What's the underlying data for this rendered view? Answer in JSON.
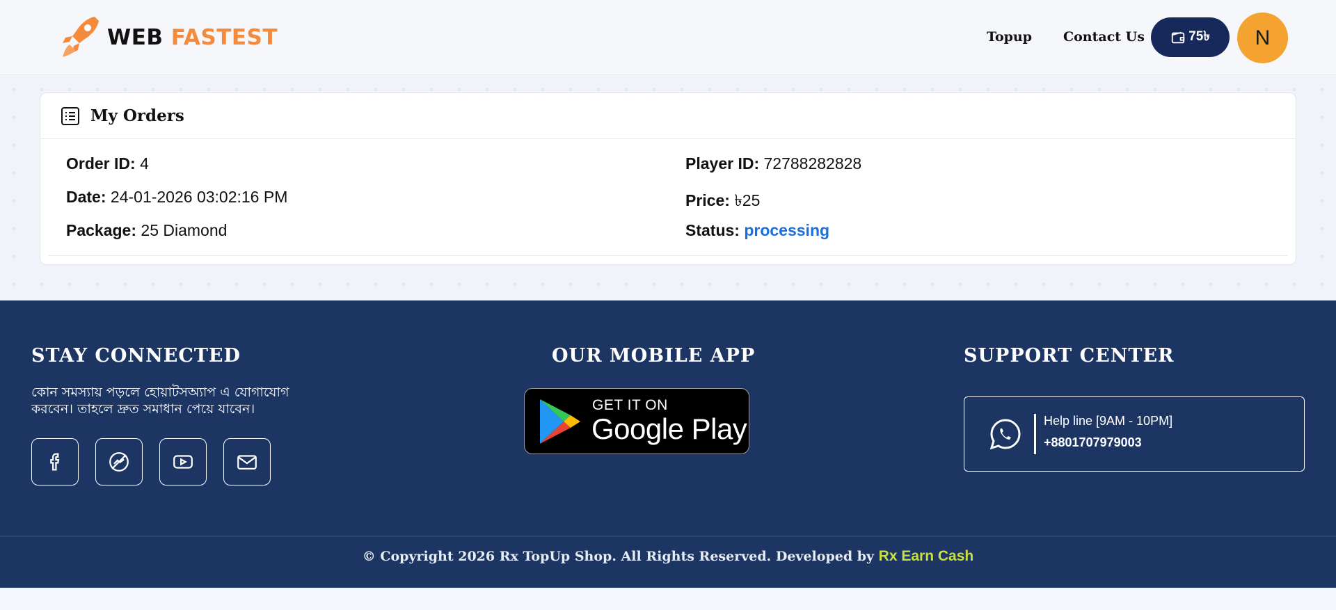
{
  "header": {
    "logo_word1": "WEB",
    "logo_word2": "FASTEST",
    "nav": {
      "topup": "Topup",
      "contact": "Contact Us"
    },
    "wallet_balance": "75৳",
    "avatar_initial": "N",
    "colors": {
      "wallet_bg": "#16295a",
      "avatar_bg": "#f4a230",
      "brand_orange": "#f58a3c"
    }
  },
  "orders": {
    "title": "My Orders",
    "icon": "list-icon",
    "fields": {
      "order_id_label": "Order ID:",
      "order_id": "4",
      "date_label": "Date:",
      "date": "24-01-2026 03:02:16 PM",
      "package_label": "Package:",
      "package": "25 Diamond",
      "player_id_label": "Player ID:",
      "player_id": "72788282828",
      "price_label": "Price:",
      "price": "৳25",
      "status_label": "Status:",
      "status": "processing"
    },
    "colors": {
      "status": "#1a6fe0"
    }
  },
  "footer": {
    "stay_connected": {
      "heading": "STAY CONNECTED",
      "text": "কোন সমস্যায় পড়লে হোয়াটসঅ্যাপ এ যোগাযোগ করবেন। তাহলে দ্রুত সমাধান পেয়ে যাবেন।",
      "socials": [
        "facebook-icon",
        "messenger-icon",
        "youtube-icon",
        "mail-icon"
      ]
    },
    "mobile_app": {
      "heading": "OUR MOBILE APP",
      "badge_small": "GET IT ON",
      "badge_large": "Google Play"
    },
    "support": {
      "heading": "SUPPORT CENTER",
      "help_line": "Help line [9AM - 10PM]",
      "phone": "+8801707979003"
    },
    "copyright_text": "© Copyright 2026 Rx TopUp Shop. All Rights Reserved. Developed by",
    "developer": "Rx Earn Cash",
    "colors": {
      "bg": "#1c3563",
      "developer": "#c8e040"
    }
  }
}
